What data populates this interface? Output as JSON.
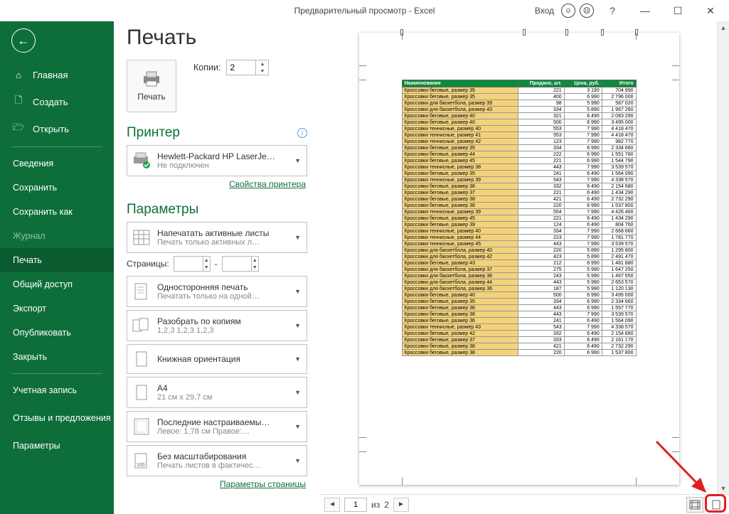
{
  "titlebar": {
    "title": "Предварительный просмотр  -  Excel",
    "login": "Вход"
  },
  "sidebar": {
    "home": "Главная",
    "create": "Создать",
    "open": "Открыть",
    "info": "Сведения",
    "save": "Сохранить",
    "saveas": "Сохранить как",
    "history": "Журнал",
    "print": "Печать",
    "share": "Общий доступ",
    "export": "Экспорт",
    "publish": "Опубликовать",
    "close": "Закрыть",
    "account": "Учетная запись",
    "feedback": "Отзывы и предложения",
    "options": "Параметры"
  },
  "heading": "Печать",
  "print_button": "Печать",
  "copies_label": "Копии:",
  "copies_value": "2",
  "printer_heading": "Принтер",
  "printer": {
    "name": "Hewlett-Packard HP LaserJe…",
    "status": "Не подключен"
  },
  "printer_props": "Свойства принтера",
  "settings_heading": "Параметры",
  "opt_sheets": {
    "title": "Напечатать активные листы",
    "sub": "Печать только активных л…"
  },
  "pages_label": "Страницы:",
  "pages_sep": "-",
  "opt_sides": {
    "title": "Односторонняя печать",
    "sub": "Печатать только на одной…"
  },
  "opt_collate": {
    "title": "Разобрать по копиям",
    "sub": "1,2,3    1,2,3    1,2,3"
  },
  "opt_orient": {
    "title": "Книжная ориентация"
  },
  "opt_size": {
    "title": "A4",
    "sub": "21 см x 29,7 см"
  },
  "opt_margins": {
    "title": "Последние настраиваемы…",
    "sub": "Левое:  1,78 см    Правое:…"
  },
  "opt_scale": {
    "title": "Без масштабирования",
    "sub": "Печать листов в фактичес…"
  },
  "page_setup_link": "Параметры страницы",
  "preview_nav": {
    "page": "1",
    "of_label": "из",
    "total": "2"
  },
  "table": {
    "headers": [
      "Наименование",
      "Продано, шт.",
      "Цена, руб.",
      "Итого"
    ],
    "rows": [
      [
        "Кроссовки беговые, размер 35",
        "221",
        "3 190",
        "704 990"
      ],
      [
        "Кроссовки беговые, размер 35",
        "400",
        "6 990",
        "2 796 000"
      ],
      [
        "Кроссовки для баскетбола, размер 39",
        "98",
        "5 990",
        "587 020"
      ],
      [
        "Кроссовки для баскетбола, размер 43",
        "334",
        "5 890",
        "1 967 260"
      ],
      [
        "Кроссовки беговые, размер 40",
        "321",
        "6 490",
        "2 083 290"
      ],
      [
        "Кроссовки беговые, размер 40",
        "500",
        "6 990",
        "3 495 000"
      ],
      [
        "Кроссовки теннисные, размер 40",
        "553",
        "7 990",
        "4 418 470"
      ],
      [
        "Кроссовки теннисные, размер 41",
        "553",
        "7 990",
        "4 418 470"
      ],
      [
        "Кроссовки теннисные, размер 42",
        "123",
        "7 990",
        "982 770"
      ],
      [
        "Кроссовки беговые, размер 35",
        "334",
        "6 990",
        "2 334 660"
      ],
      [
        "Кроссовки беговые, размер 44",
        "222",
        "6 990",
        "1 551 780"
      ],
      [
        "Кроссовки беговые, размер 45",
        "221",
        "6 990",
        "1 544 790"
      ],
      [
        "Кроссовки теннисные, размер 38",
        "443",
        "7 990",
        "3 539 570"
      ],
      [
        "Кроссовки беговые, размер 35",
        "241",
        "6 490",
        "1 564 090"
      ],
      [
        "Кроссовки теннисные, размер 39",
        "543",
        "7 990",
        "4 338 570"
      ],
      [
        "Кроссовки беговые, размер 36",
        "332",
        "6 490",
        "2 154 680"
      ],
      [
        "Кроссовки беговые, размер 37",
        "221",
        "6 490",
        "1 434 290"
      ],
      [
        "Кроссовки беговые, размер 38",
        "421",
        "6 490",
        "2 732 290"
      ],
      [
        "Кроссовки беговые, размер 38",
        "220",
        "6 990",
        "1 537 800"
      ],
      [
        "Кроссовки теннисные, размер 39",
        "554",
        "7 990",
        "4 426 460"
      ],
      [
        "Кроссовки беговые, размер 45",
        "221",
        "6 490",
        "1 434 290"
      ],
      [
        "Кроссовки беговые, размер 39",
        "124",
        "6 490",
        "804 760"
      ],
      [
        "Кроссовки теннисные, размер 40",
        "334",
        "7 990",
        "2 668 660"
      ],
      [
        "Кроссовки теннисные, размер 44",
        "223",
        "7 990",
        "1 781 770"
      ],
      [
        "Кроссовки теннисные, размер 45",
        "443",
        "7 990",
        "3 539 570"
      ],
      [
        "Кроссовки для баскетбола, размер 40",
        "220",
        "5 890",
        "1 295 800"
      ],
      [
        "Кроссовки для баскетбола, размер 42",
        "423",
        "5 890",
        "2 491 470"
      ],
      [
        "Кроссовки беговые, размер 43",
        "212",
        "6 990",
        "1 481 880"
      ],
      [
        "Кроссовки для баскетбола, размер 37",
        "275",
        "5 990",
        "1 647 250"
      ],
      [
        "Кроссовки для баскетбола, размер 38",
        "243",
        "5 990",
        "1 467 550"
      ],
      [
        "Кроссовки для баскетбола, размер 44",
        "443",
        "5 990",
        "2 653 570"
      ],
      [
        "Кроссовки для баскетбола, размер 36",
        "187",
        "5 990",
        "1 120 130"
      ],
      [
        "Кроссовки беговые, размер 40",
        "500",
        "6 990",
        "3 495 000"
      ],
      [
        "Кроссовки беговые, размер 35",
        "334",
        "6 990",
        "2 334 660"
      ],
      [
        "Кроссовки беговые, размер 36",
        "443",
        "6 990",
        "1 557 770"
      ],
      [
        "Кроссовки беговые, размер 38",
        "443",
        "7 990",
        "3 539 570"
      ],
      [
        "Кроссовки беговые, размер 36",
        "241",
        "6 490",
        "1 564 090"
      ],
      [
        "Кроссовки теннисные, размер 43",
        "543",
        "7 990",
        "4 338 570"
      ],
      [
        "Кроссовки беговые, размер 42",
        "332",
        "6 490",
        "2 154 680"
      ],
      [
        "Кроссовки беговые, размер 37",
        "333",
        "6 490",
        "2 161 170"
      ],
      [
        "Кроссовки беговые, размер 38",
        "421",
        "6 490",
        "2 732 290"
      ],
      [
        "Кроссовки беговые, размер 38",
        "220",
        "6 990",
        "1 537 800"
      ]
    ]
  }
}
